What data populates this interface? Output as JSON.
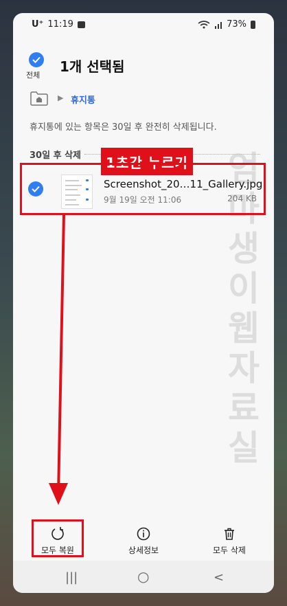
{
  "status_bar": {
    "carrier": "U⁺",
    "time": "11:19",
    "battery": "73%"
  },
  "header": {
    "select_all_label": "전체",
    "title": "1개 선택됨"
  },
  "breadcrumb": {
    "current": "휴지통"
  },
  "notice": "휴지통에 있는 항목은 30일 후 완전히 삭제됩니다.",
  "section_title": "30일 후 삭제",
  "annotation": {
    "label": "1초간 누르기",
    "color": "#e0101b"
  },
  "watermark": [
    "엄",
    "마",
    "생",
    "이",
    "웹",
    "자",
    "료",
    "실"
  ],
  "file": {
    "name": "Screenshot_20…11_Gallery.jpg",
    "date": "9월 19일 오전 11:06",
    "size": "204 KB"
  },
  "bottom_actions": {
    "restore_all": "모두 복원",
    "details": "상세정보",
    "delete_all": "모두 삭제"
  },
  "nav": {
    "recents": "|||",
    "home": "○",
    "back": "<"
  },
  "colors": {
    "accent": "#2f7ff0",
    "link": "#2f6bd6",
    "highlight": "#e0101b"
  }
}
